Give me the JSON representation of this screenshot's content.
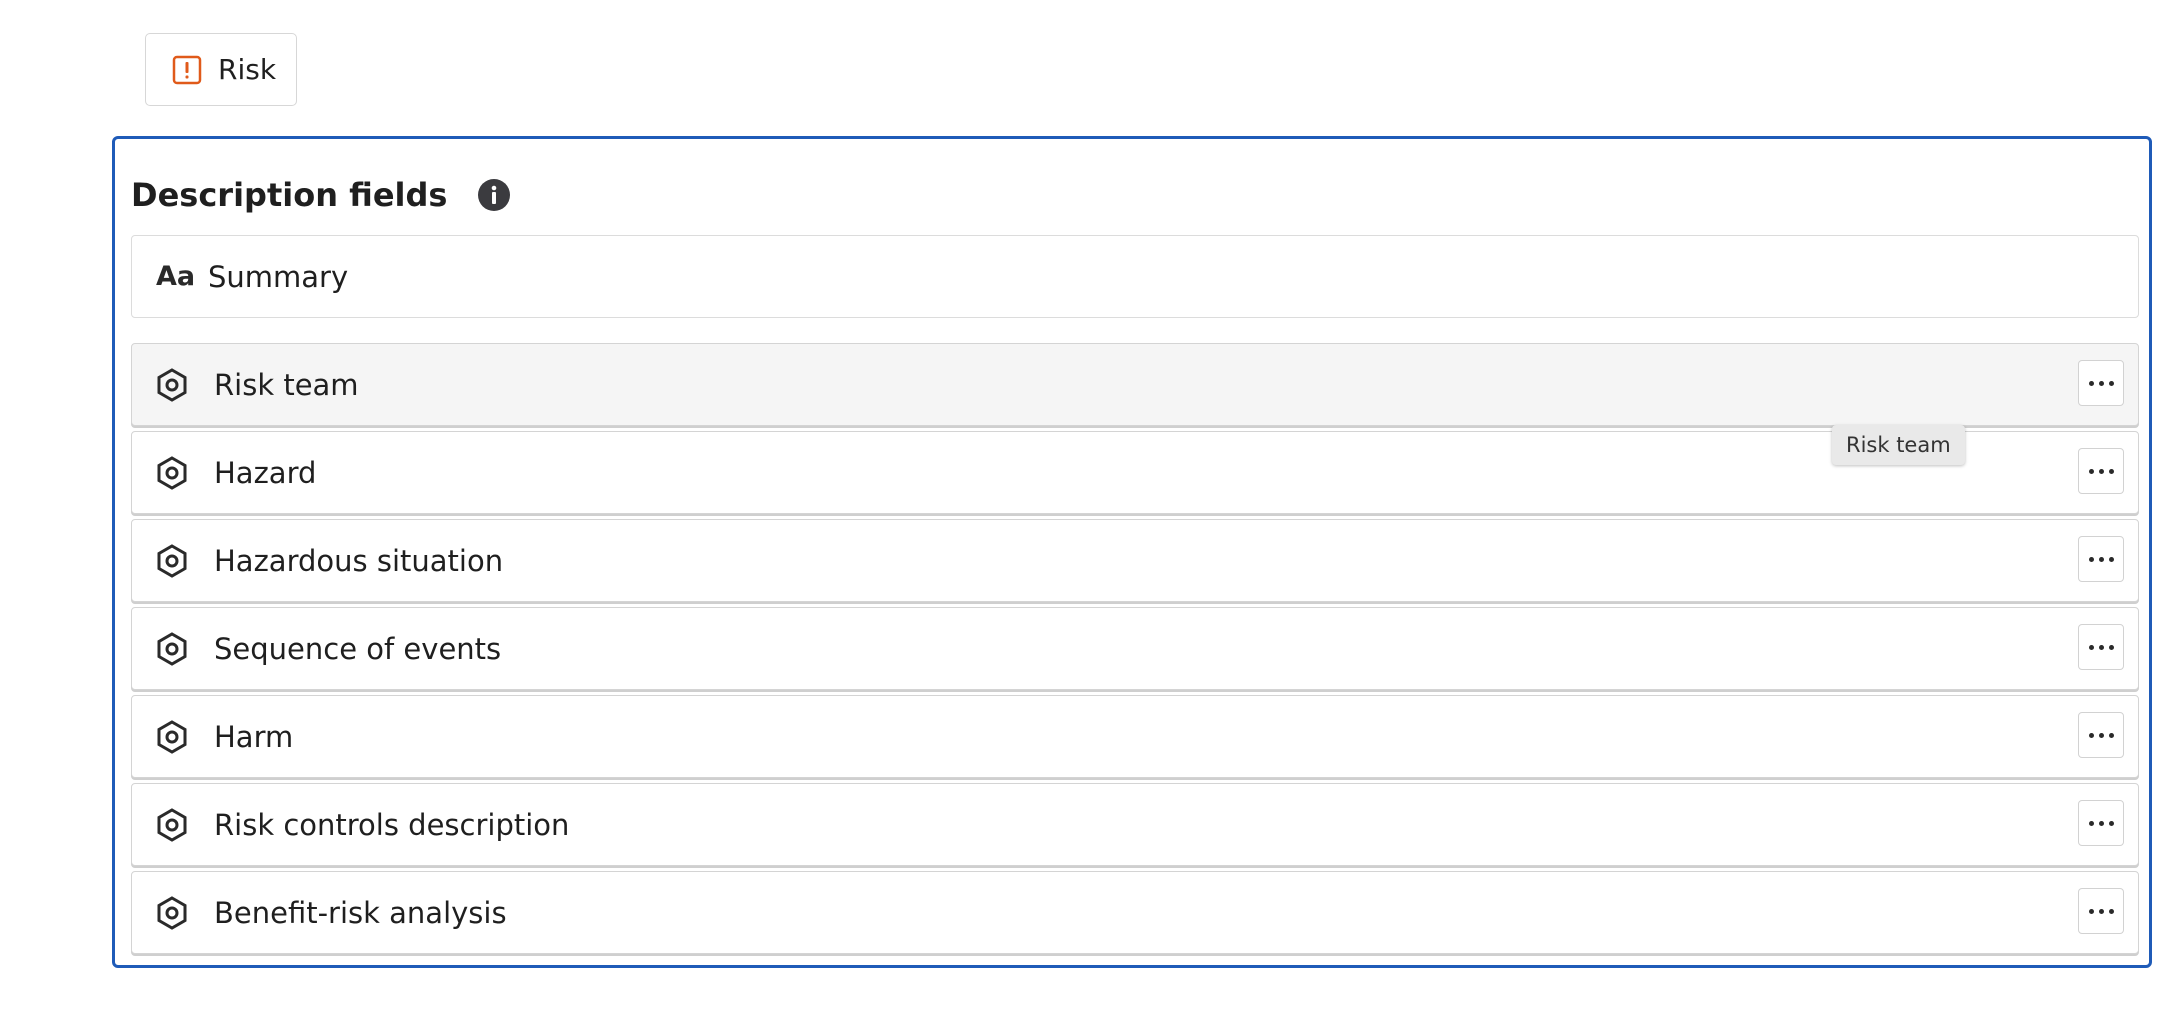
{
  "chip": {
    "label": "Risk",
    "icon": "alert-square-icon",
    "icon_color": "#e05a1a"
  },
  "section": {
    "title": "Description fields",
    "info_icon": "info-icon"
  },
  "summary_field": {
    "icon_text": "Aa",
    "label": "Summary"
  },
  "fields": [
    {
      "label": "Risk team"
    },
    {
      "label": "Hazard"
    },
    {
      "label": "Hazardous situation"
    },
    {
      "label": "Sequence of events"
    },
    {
      "label": "Harm"
    },
    {
      "label": "Risk controls description"
    },
    {
      "label": "Benefit-risk analysis"
    }
  ],
  "tooltip": {
    "text": "Risk team"
  },
  "colors": {
    "panel_border": "#1f5bb8",
    "hover_row": "#f5f5f5"
  }
}
